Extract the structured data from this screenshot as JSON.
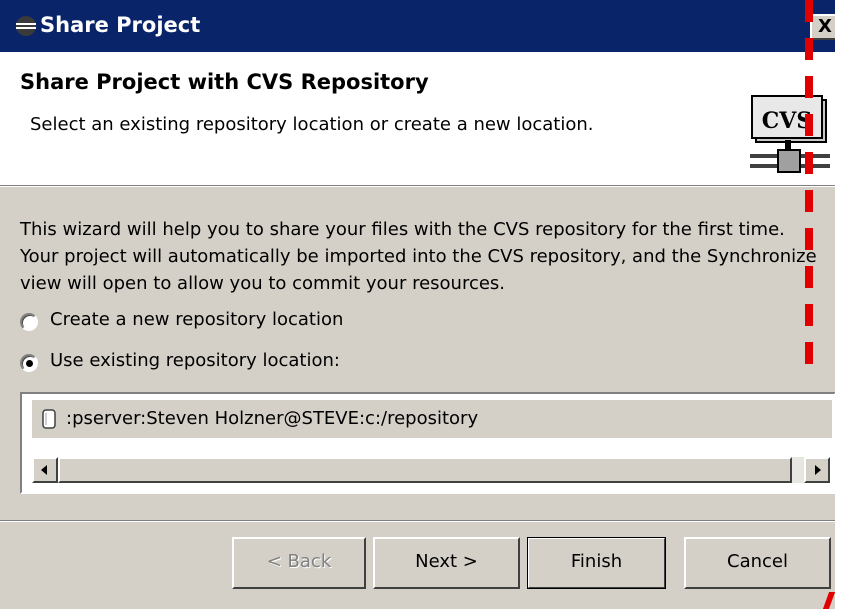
{
  "window": {
    "title": "Share Project",
    "close_label": "X"
  },
  "header": {
    "title": "Share Project with CVS Repository",
    "description": "Select an existing repository location or create a new location.",
    "logo_text": "CVS"
  },
  "body": {
    "intro": "This wizard will help you to share your files with the CVS repository for the first time. Your project will automatically be imported into the CVS repository, and the Synchronize view will open to allow you to commit your resources.",
    "radio_create": {
      "label": "Create a new repository location",
      "selected": false
    },
    "radio_existing": {
      "label": "Use existing repository location:",
      "selected": true
    },
    "repositories": [
      {
        "location": ":pserver:Steven Holzner@STEVE:c:/repository",
        "selected": true
      }
    ]
  },
  "buttons": {
    "back": "< Back",
    "next": "Next >",
    "finish": "Finish",
    "cancel": "Cancel"
  },
  "colors": {
    "titlebar": "#0a246a",
    "dialog_bg": "#d4d0c8",
    "annotation": "#e00000"
  }
}
